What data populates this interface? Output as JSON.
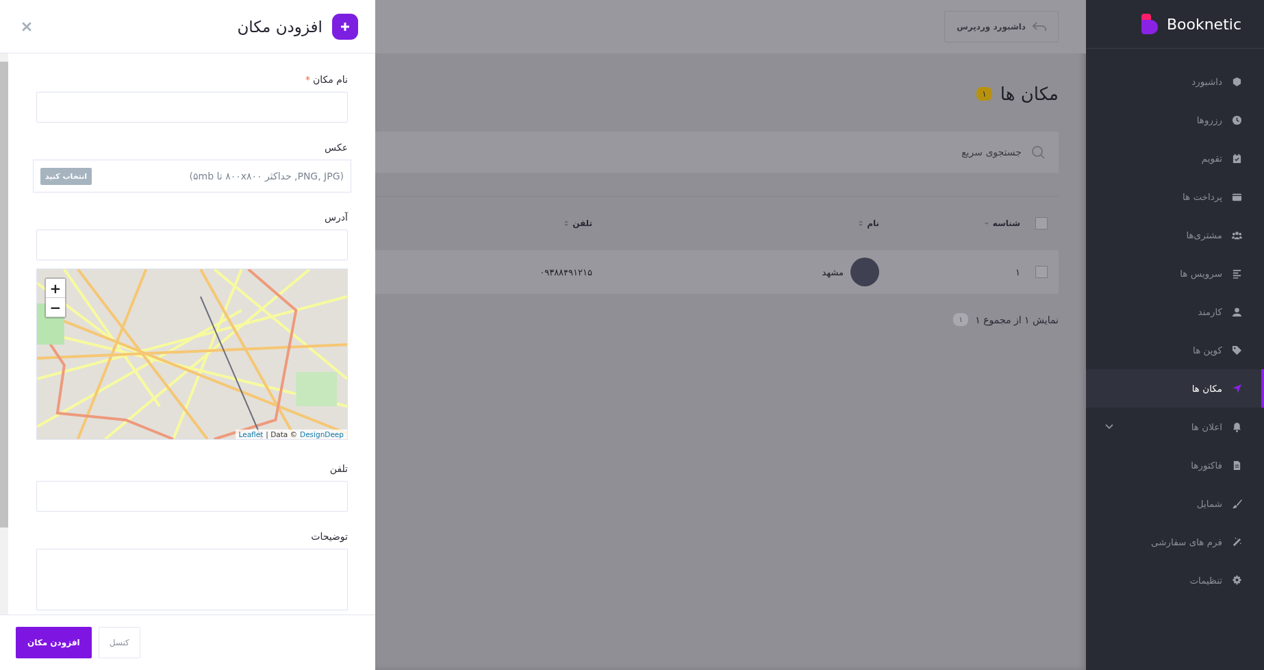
{
  "panel": {
    "title": "افزودن مکان",
    "fields": [
      {
        "kind": "text",
        "label": "نام مکان",
        "required_mark": "*"
      },
      {
        "kind": "file",
        "label": "عکس",
        "placeholder": "(PNG, JPG, حداکثر ۸۰۰x۸۰۰ تا ۵mb)",
        "button": "انتخاب کنید"
      },
      {
        "kind": "text",
        "label": "آدرس"
      },
      {
        "kind": "map",
        "zoom_in": "+",
        "zoom_out": "−",
        "attribution_link": "Leaflet",
        "attribution_text": "| Data ©",
        "attribution_source": "DesignDeep"
      },
      {
        "kind": "text",
        "label": "تلفن"
      },
      {
        "kind": "textarea",
        "label": "توضیحات"
      }
    ],
    "submit": "افزودن مکان",
    "cancel": "کنسل"
  },
  "topbar": {
    "wp_button": "داشبورد وردپرس"
  },
  "page": {
    "title": "مکان ها",
    "count": "۱"
  },
  "search": {
    "placeholder": "جستجوی سریع"
  },
  "table": {
    "select_all_checked": false,
    "columns": [
      {
        "label": "شناسه",
        "sorted": true
      },
      {
        "label": "نام",
        "sorted": false
      },
      {
        "label": "تلفن",
        "sorted": false
      }
    ],
    "rows": [
      {
        "checked": false,
        "id": "۱",
        "name": "مشهد",
        "phone": "۰۹۳۸۸۴۹۱۲۱۵"
      }
    ]
  },
  "pagination": {
    "summary": "نمایش ۱ از مجموع ۱",
    "page": "۱"
  },
  "sidebar": {
    "brand": "Booknetic",
    "items": [
      {
        "label": "داشبورد",
        "selected": false,
        "expandable": false
      },
      {
        "label": "رزروها",
        "selected": false,
        "expandable": false
      },
      {
        "label": "تقویم",
        "selected": false,
        "expandable": false
      },
      {
        "label": "پرداخت ها",
        "selected": false,
        "expandable": false
      },
      {
        "label": "مشتری‌ها",
        "selected": false,
        "expandable": false
      },
      {
        "label": "سرویس ها",
        "selected": false,
        "expandable": false
      },
      {
        "label": "کارمند",
        "selected": false,
        "expandable": false
      },
      {
        "label": "کوپن ها",
        "selected": false,
        "expandable": false
      },
      {
        "label": "مکان ها",
        "selected": true,
        "expandable": false
      },
      {
        "label": "اعلان ها",
        "selected": false,
        "expandable": true
      },
      {
        "label": "فاکتورها",
        "selected": false,
        "expandable": false
      },
      {
        "label": "شمایل",
        "selected": false,
        "expandable": false
      },
      {
        "label": "فرم های سفارشی",
        "selected": false,
        "expandable": false
      },
      {
        "label": "تنظیمات",
        "selected": false,
        "expandable": false
      }
    ]
  }
}
